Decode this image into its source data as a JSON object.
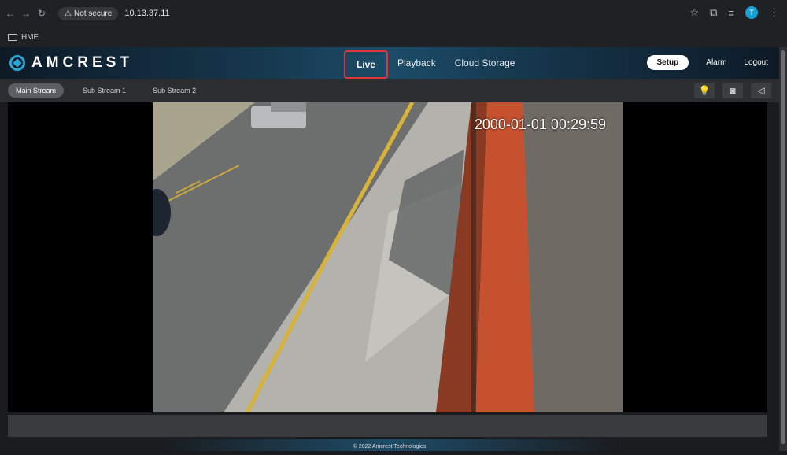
{
  "browser": {
    "secure_label": "Not secure",
    "url": "10.13.37.11",
    "profile_initial": "T"
  },
  "bookmarks": {
    "items": [
      "HME"
    ]
  },
  "app": {
    "brand": "AMCREST",
    "nav": [
      "Live",
      "Playback",
      "Cloud Storage"
    ],
    "setup_label": "Setup",
    "alarm_label": "Alarm",
    "logout_label": "Logout"
  },
  "streams": {
    "tabs": [
      "Main Stream",
      "Sub Stream 1",
      "Sub Stream 2"
    ]
  },
  "video": {
    "timestamp": "2000-01-01 00:29:59"
  },
  "footer": {
    "copyright": "© 2022 Amcrest Technologies"
  },
  "colors": {
    "accent": "#2aa6d6",
    "highlight": "#e0353a"
  }
}
